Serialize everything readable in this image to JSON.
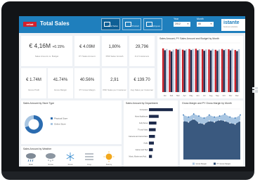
{
  "app": {
    "title": "Total Sales",
    "logo_text": "orbat",
    "brand": "istante",
    "brand_sub": "business solutions"
  },
  "nav": [
    {
      "label": "Total Sales",
      "active": true
    },
    {
      "label": "Product",
      "active": false
    },
    {
      "label": "Employees",
      "active": false
    }
  ],
  "filters": {
    "year_label": "Year",
    "year_value": "2012",
    "month_label": "Month",
    "month_value": "All"
  },
  "kpis": [
    {
      "value": "€ 4,16M",
      "delta": "+0.15%",
      "label": "Sales Amount vs. Budget"
    },
    {
      "value": "€ 4.09M",
      "label": "PY Sales Amount"
    },
    {
      "value": "1,80%",
      "label": "PDF Sales Growth"
    },
    {
      "value": "29,796",
      "label": "# of Customers"
    },
    {
      "value": "€ 1.74M",
      "label": "Gross Profit"
    },
    {
      "value": "41.74%",
      "label": "Gross Margin"
    },
    {
      "value": "40.56%",
      "label": "PY Gross Margin"
    },
    {
      "value": "2,91",
      "label": "PDF Sales per Customer"
    },
    {
      "value": "€ 139.70",
      "label": "Avg Sales per Customer"
    }
  ],
  "panels": {
    "monthly_title": "Sales Amount, PY Sales Amount and Budget by Month",
    "store_type_title": "Sales Amount by Store Type",
    "department_title": "Sales Amount by Department",
    "margin_title": "Gross Margin and PY Gross Margin by Month",
    "weather_title": "Sales Amount by Weather"
  },
  "store_type_legend": [
    "Physical Store",
    "Online Store"
  ],
  "colors": {
    "header_blue": "#1f7fbd",
    "series_red": "#c9202a",
    "series_navy": "#1d2a4b",
    "series_light": "#b7c8dd",
    "series_blue": "#2b6cb0",
    "area_light": "#a9c6e2",
    "area_dark": "#2d4c74"
  },
  "weather": [
    {
      "name": "Rain",
      "icon": "rain-icon"
    },
    {
      "name": "Snow",
      "icon": "snow-icon"
    },
    {
      "name": "Frost",
      "icon": "snowflake-icon"
    },
    {
      "name": "Fog",
      "icon": "fog-icon"
    },
    {
      "name": "Sunny",
      "icon": "sun-icon"
    }
  ],
  "chart_data": [
    {
      "type": "bar",
      "title": "Sales Amount, PY Sales Amount and Budget by Month",
      "categories": [
        "Jan",
        "Feb",
        "Mar",
        "Apr",
        "May",
        "Jun",
        "Jul",
        "Aug",
        "Sep",
        "Oct",
        "Nov",
        "Dec"
      ],
      "series": [
        {
          "name": "Sales Amount",
          "values": [
            355,
            340,
            350,
            345,
            350,
            352,
            348,
            346,
            344,
            350,
            348,
            342
          ]
        },
        {
          "name": "PY Sales Amount",
          "values": [
            340,
            330,
            345,
            338,
            342,
            340,
            336,
            338,
            335,
            341,
            339,
            333
          ]
        },
        {
          "name": "Budget",
          "values": [
            350,
            345,
            352,
            348,
            350,
            349,
            347,
            350,
            346,
            349,
            351,
            348
          ]
        }
      ],
      "ylim": [
        0,
        400
      ],
      "grid": true
    },
    {
      "type": "pie",
      "title": "Sales Amount by Store Type",
      "categories": [
        "Physical Store",
        "Online Store"
      ],
      "values": [
        70,
        30
      ]
    },
    {
      "type": "bar",
      "title": "Sales Amount by Department",
      "categories": [
        "Computers",
        "Home Appliances",
        "Cell phones",
        "TV and Video",
        "Cameras and camcorders",
        "Audio",
        "Games and Toys",
        "Music, Movies and Audio Books"
      ],
      "values": [
        1.6,
        0.65,
        0.5,
        0.45,
        0.4,
        0.33,
        0.26,
        0.2
      ]
    },
    {
      "type": "area",
      "title": "Gross Margin and PY Gross Margin by Month",
      "categories": [
        "Jan",
        "Feb",
        "Mar",
        "Apr",
        "May",
        "Jun",
        "Jul",
        "Aug",
        "Sep",
        "Oct",
        "Nov",
        "Dec"
      ],
      "series": [
        {
          "name": "Gross Margin",
          "values": [
            44,
            42,
            45,
            43,
            41,
            44,
            42,
            43,
            45,
            42,
            41,
            44
          ]
        },
        {
          "name": "PY Gross Margin",
          "values": [
            38,
            37,
            40,
            36,
            35,
            38,
            37,
            39,
            38,
            36,
            35,
            38
          ]
        }
      ],
      "ylim": [
        0,
        50
      ],
      "grid": true
    }
  ]
}
